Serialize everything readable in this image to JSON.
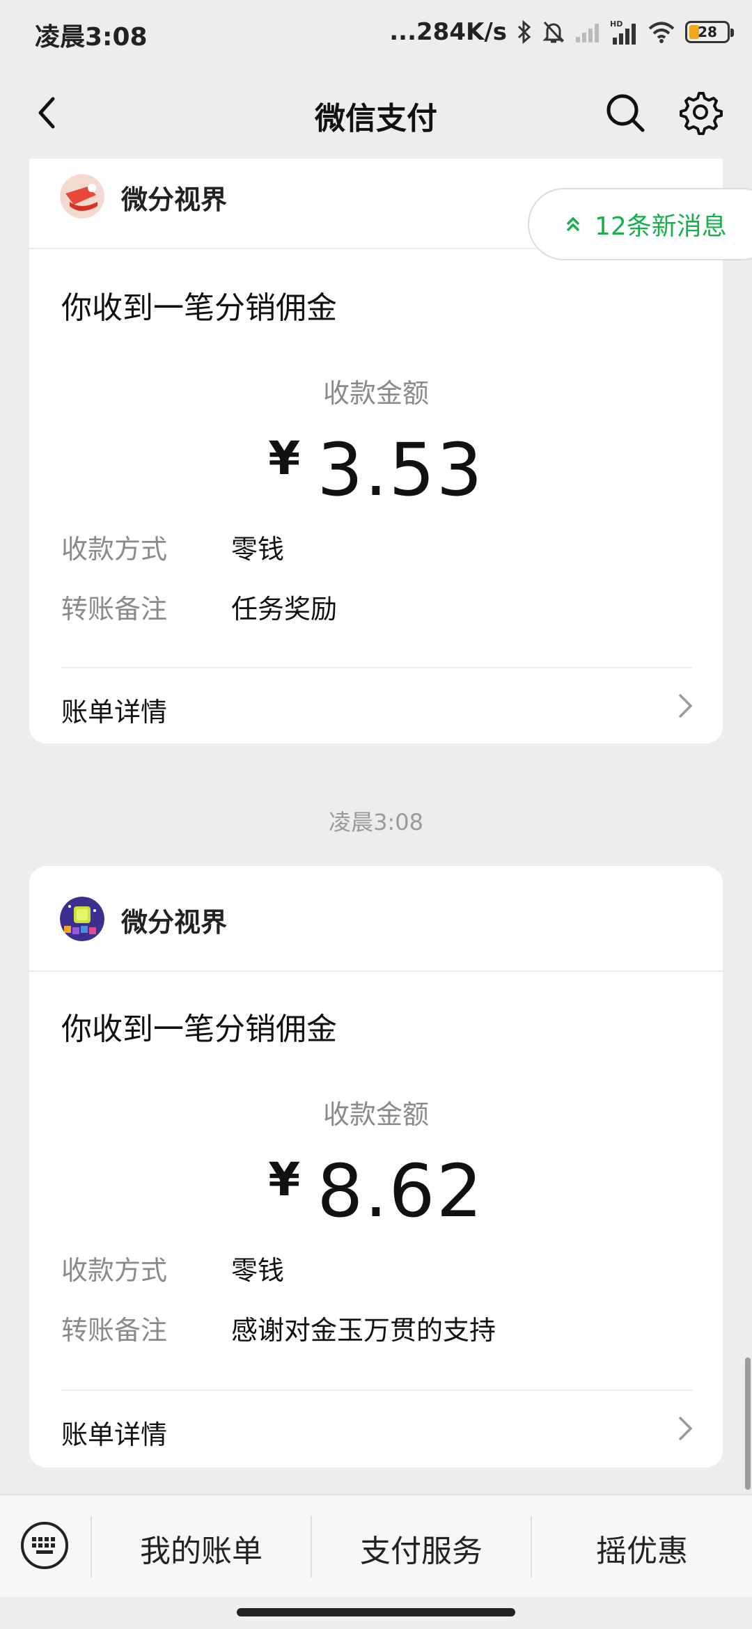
{
  "status_bar": {
    "time": "凌晨3:08",
    "network_speed": "...284K/s",
    "battery": "28"
  },
  "header": {
    "title": "微信支付",
    "back_icon": "back-arrow-icon",
    "search_icon": "search-icon",
    "settings_icon": "gear-icon"
  },
  "new_messages": {
    "label": "12条新消息",
    "icon": "double-chevron-up-icon"
  },
  "messages": [
    {
      "merchant": "微分视界",
      "headline": "你收到一笔分销佣金",
      "amount_label": "收款金额",
      "currency": "¥",
      "amount": "3.53",
      "method_label": "收款方式",
      "method_value": "零钱",
      "note_label": "转账备注",
      "note_value": "任务奖励",
      "detail_label": "账单详情"
    },
    {
      "merchant": "微分视界",
      "headline": "你收到一笔分销佣金",
      "amount_label": "收款金额",
      "currency": "¥",
      "amount": "8.62",
      "method_label": "收款方式",
      "method_value": "零钱",
      "note_label": "转账备注",
      "note_value": "感谢对金玉万贯的支持",
      "detail_label": "账单详情"
    }
  ],
  "timestamp": "凌晨3:08",
  "bottom_menu": {
    "keyboard_icon": "keyboard-icon",
    "items": [
      "我的账单",
      "支付服务",
      "摇优惠"
    ]
  },
  "colors": {
    "accent": "#14b14b",
    "background": "#ededed"
  }
}
